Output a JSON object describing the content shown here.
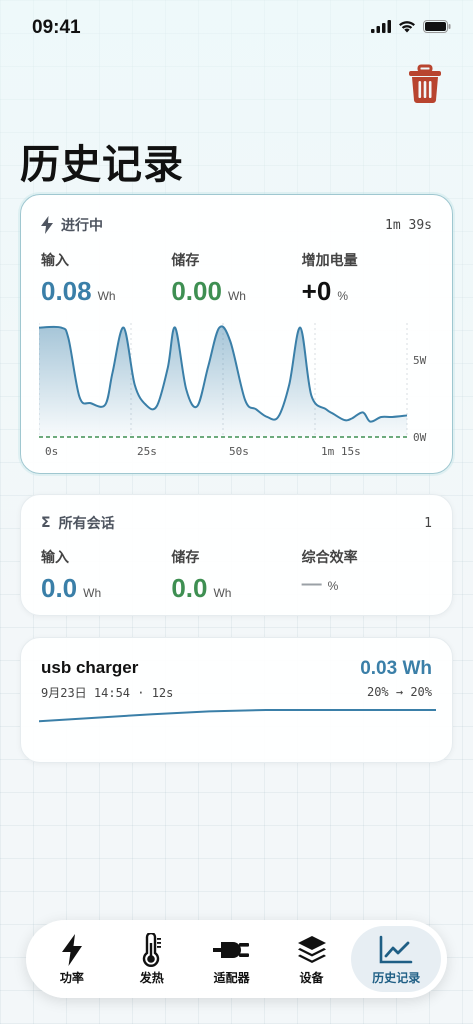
{
  "status": {
    "time": "09:41"
  },
  "page": {
    "title": "历史记录"
  },
  "active_session": {
    "header_label": "进行中",
    "elapsed": "1m 39s",
    "metrics": [
      {
        "label": "输入",
        "value": "0.08",
        "unit": "Wh",
        "color": "#3a7fa8"
      },
      {
        "label": "储存",
        "value": "0.00",
        "unit": "Wh",
        "color": "#3e8f52"
      },
      {
        "label": "增加电量",
        "value": "+0",
        "unit": "%",
        "color": "#111111"
      }
    ]
  },
  "chart_data": {
    "type": "area",
    "x_tick_labels": [
      "0s",
      "25s",
      "50s",
      "1m 15s"
    ],
    "y_tick_labels": [
      "5W",
      "0W"
    ],
    "x_unit": "s",
    "y_unit": "W",
    "xlim": [
      0,
      100
    ],
    "ylim": [
      0,
      7.4
    ],
    "x": [
      0,
      6,
      8,
      11,
      14,
      18,
      20,
      23,
      26,
      29,
      32,
      35,
      37,
      40,
      43,
      46,
      49,
      52,
      56,
      59,
      62,
      65,
      68,
      71,
      74,
      78,
      80,
      83,
      85,
      88,
      90,
      93,
      96,
      100
    ],
    "values": [
      7.1,
      7.1,
      6.4,
      2.6,
      2.2,
      2.1,
      4.2,
      7.1,
      3.4,
      2.1,
      2.0,
      4.5,
      7.1,
      3.1,
      2.0,
      4.6,
      7.1,
      6.2,
      2.4,
      1.8,
      1.3,
      1.3,
      3.4,
      7.1,
      2.7,
      1.8,
      1.5,
      1.1,
      1.2,
      1.6,
      1.0,
      1.3,
      1.3,
      1.4
    ],
    "line_color": "#3a7fa8",
    "baseline_color": "#3e8f52",
    "grid": true
  },
  "all_sessions": {
    "header_label": "所有会话",
    "count": "1",
    "metrics": [
      {
        "label": "输入",
        "value": "0.0",
        "unit": "Wh",
        "color": "#3a7fa8"
      },
      {
        "label": "储存",
        "value": "0.0",
        "unit": "Wh",
        "color": "#3e8f52"
      },
      {
        "label": "综合效率",
        "value": "—",
        "unit": "%",
        "color": "#9aa0a6"
      }
    ]
  },
  "sessions": [
    {
      "name": "usb charger",
      "meta": "9月23日 14:54 · 12s",
      "energy": "0.03 Wh",
      "battery": "20% → 20%",
      "sparkline": [
        0.2,
        0.45,
        0.7,
        0.9,
        1.0,
        1.0,
        1.0,
        1.0
      ]
    }
  ],
  "tabs": [
    {
      "label": "功率",
      "icon": "bolt-icon",
      "selected": false
    },
    {
      "label": "发热",
      "icon": "thermometer-icon",
      "selected": false
    },
    {
      "label": "适配器",
      "icon": "power-plug-icon",
      "selected": false
    },
    {
      "label": "设备",
      "icon": "layers-icon",
      "selected": false
    },
    {
      "label": "历史记录",
      "icon": "chart-line-icon",
      "selected": true
    }
  ]
}
